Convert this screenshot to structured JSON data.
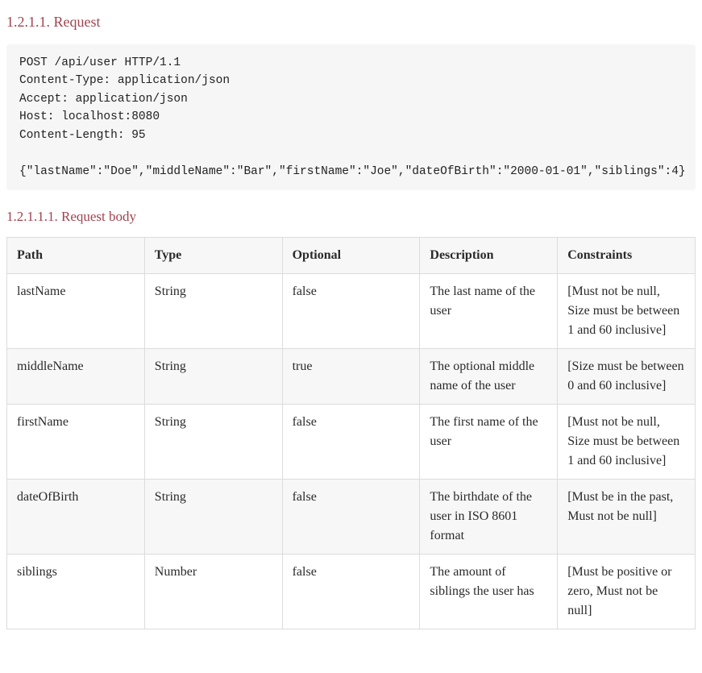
{
  "request": {
    "heading": "1.2.1.1. Request",
    "code": "POST /api/user HTTP/1.1\nContent-Type: application/json\nAccept: application/json\nHost: localhost:8080\nContent-Length: 95\n\n{\"lastName\":\"Doe\",\"middleName\":\"Bar\",\"firstName\":\"Joe\",\"dateOfBirth\":\"2000-01-01\",\"siblings\":4}"
  },
  "body": {
    "heading": "1.2.1.1.1. Request body",
    "headers": {
      "path": "Path",
      "type": "Type",
      "optional": "Optional",
      "description": "Description",
      "constraints": "Constraints"
    },
    "rows": [
      {
        "path": "lastName",
        "type": "String",
        "optional": "false",
        "description": "The last name of the user",
        "constraints": "[Must not be null, Size must be between 1 and 60 inclusive]"
      },
      {
        "path": "middleName",
        "type": "String",
        "optional": "true",
        "description": "The optional middle name of the user",
        "constraints": "[Size must be between 0 and 60 inclusive]"
      },
      {
        "path": "firstName",
        "type": "String",
        "optional": "false",
        "description": "The first name of the user",
        "constraints": "[Must not be null, Size must be between 1 and 60 inclusive]"
      },
      {
        "path": "dateOfBirth",
        "type": "String",
        "optional": "false",
        "description": "The birthdate of the user in ISO 8601 format",
        "constraints": "[Must be in the past, Must not be null]"
      },
      {
        "path": "siblings",
        "type": "Number",
        "optional": "false",
        "description": "The amount of siblings the user has",
        "constraints": "[Must be positive or zero, Must not be null]"
      }
    ]
  }
}
